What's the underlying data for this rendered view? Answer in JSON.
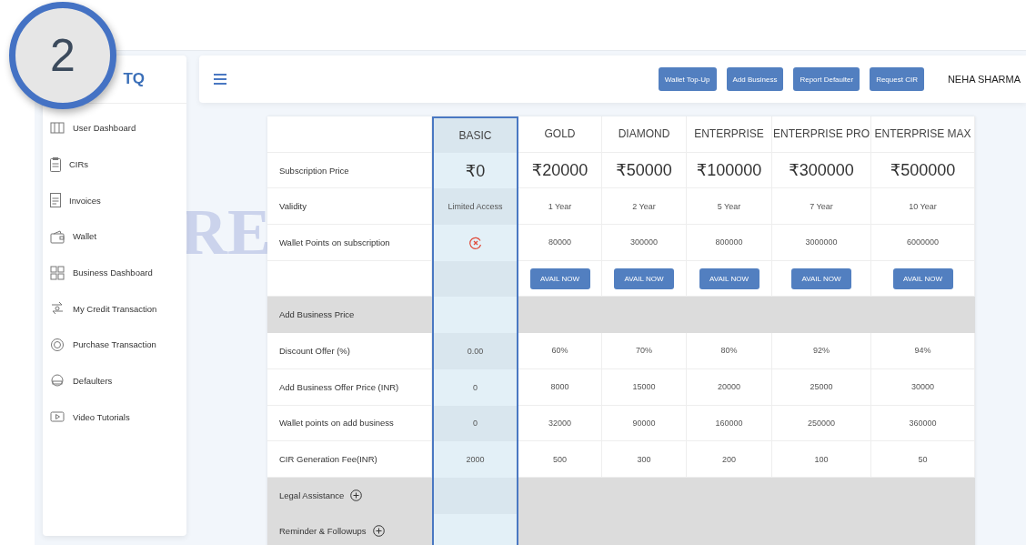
{
  "step_badge": "2",
  "logo": {
    "text": "TQ"
  },
  "sidebar": {
    "items": [
      {
        "label": "User Dashboard"
      },
      {
        "label": "CIRs"
      },
      {
        "label": "Invoices"
      },
      {
        "label": "Wallet"
      },
      {
        "label": "Business Dashboard"
      },
      {
        "label": "My Credit Transaction"
      },
      {
        "label": "Purchase Transaction"
      },
      {
        "label": "Defaulters"
      },
      {
        "label": "Video Tutorials"
      }
    ]
  },
  "topbar": {
    "buttons": [
      "Wallet Top-Up",
      "Add Business",
      "Report Defaulter",
      "Request CIR"
    ],
    "user": "NEHA SHARMA"
  },
  "background_text": "RE",
  "plans": {
    "columns": [
      {
        "name": "BASIC",
        "selected": true
      },
      {
        "name": "GOLD",
        "selected": false
      },
      {
        "name": "DIAMOND",
        "selected": false
      },
      {
        "name": "ENTERPRISE",
        "selected": false
      },
      {
        "name": "ENTERPRISE PRO",
        "selected": false
      },
      {
        "name": "ENTERPRISE MAX",
        "selected": false
      }
    ],
    "rows": [
      {
        "kind": "price",
        "label": "Subscription Price",
        "cells": [
          "₹0",
          "₹20000",
          "₹50000",
          "₹100000",
          "₹300000",
          "₹500000"
        ]
      },
      {
        "kind": "value",
        "label": "Validity",
        "cells": [
          "Limited Access",
          "1 Year",
          "2 Year",
          "5 Year",
          "7 Year",
          "10 Year"
        ]
      },
      {
        "kind": "value",
        "label": "Wallet Points on subscription",
        "cells": [
          {
            "kind": "unavailable"
          },
          "80000",
          "300000",
          "800000",
          "3000000",
          "6000000"
        ]
      },
      {
        "kind": "value",
        "cells": [
          {
            "kind": "empty"
          },
          {
            "kind": "button",
            "label": "AVAIL NOW"
          },
          {
            "kind": "button",
            "label": "AVAIL NOW"
          },
          {
            "kind": "button",
            "label": "AVAIL NOW"
          },
          {
            "kind": "button",
            "label": "AVAIL NOW"
          },
          {
            "kind": "button",
            "label": "AVAIL NOW"
          }
        ]
      },
      {
        "kind": "section",
        "label": "Add Business Price"
      },
      {
        "kind": "value",
        "label": "Discount Offer (%)",
        "cells": [
          "0.00",
          "60%",
          "70%",
          "80%",
          "92%",
          "94%"
        ]
      },
      {
        "kind": "value",
        "label": "Add Business Offer Price (INR)",
        "cells": [
          "0",
          "8000",
          "15000",
          "20000",
          "25000",
          "30000"
        ]
      },
      {
        "kind": "value",
        "label": "Wallet points on add business",
        "cells": [
          "0",
          "32000",
          "90000",
          "160000",
          "250000",
          "360000"
        ]
      },
      {
        "kind": "value",
        "label": "CIR Generation Fee(INR)",
        "cells": [
          "2000",
          "500",
          "300",
          "200",
          "100",
          "50"
        ]
      },
      {
        "kind": "section",
        "label": "Legal Assistance",
        "expandable": true
      },
      {
        "kind": "section",
        "label": "Reminder & Followups",
        "expandable": true
      }
    ]
  }
}
